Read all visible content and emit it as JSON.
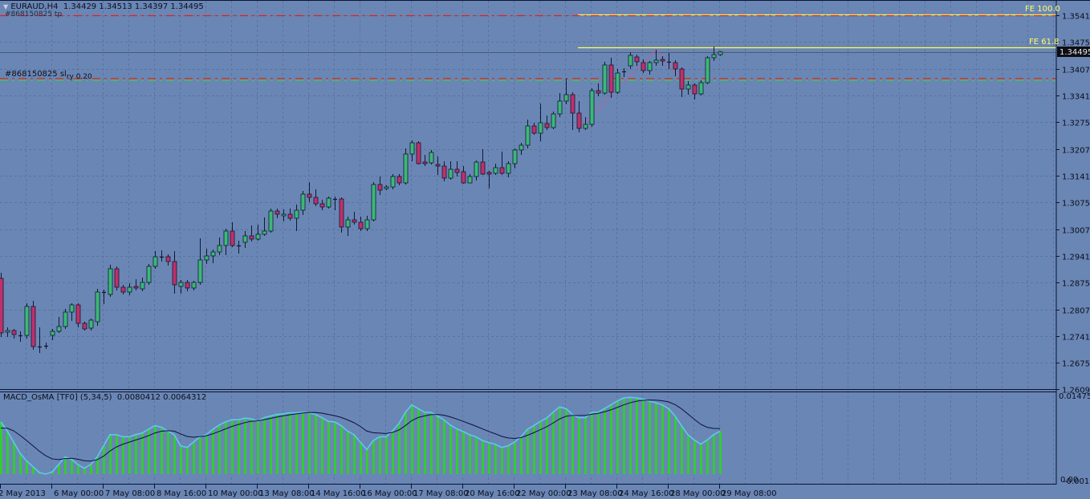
{
  "window": {
    "symbol_title": "EURAUD,H4",
    "ohlc_readout": "1.34429 1.34513 1.34397 1.34495"
  },
  "orders": {
    "tp_label": "#868150825 tp",
    "tp_price": 1.354,
    "sl_label": "#868150825 sl",
    "sl_suffix": "ry 0.20",
    "sl_price": 1.3383
  },
  "fibo": {
    "fe100_label": "FE 100.0",
    "fe100_price": 1.3543,
    "fe618_label": "FE 61.8",
    "fe618_price": 1.3461,
    "points": [
      [
        90,
        1.3259
      ],
      [
        102,
        1.3455
      ],
      [
        108,
        1.3343
      ]
    ]
  },
  "current_price": {
    "label": "1.34495",
    "value": 1.34495
  },
  "colors": {
    "background": "#6a86b5",
    "bull": "#3cb878",
    "bear": "#c0306a",
    "wick": "#0e1a33",
    "tp_line": "#e02020",
    "sl_line_green": "#3cd23c",
    "fibo_lines": "#ffff55",
    "fibo_trend": "#e0508a",
    "histogram": "#33cc33",
    "histogram_outline": "#5ec8f0",
    "signal": "#0a1040"
  },
  "price_axis": {
    "ticks": [
      "1.35410",
      "1.34750",
      "1.34070",
      "1.33410",
      "1.32750",
      "1.32070",
      "1.31410",
      "1.30750",
      "1.30070",
      "1.29410",
      "1.28750",
      "1.28070",
      "1.27410",
      "1.26750",
      "1.26090"
    ]
  },
  "time_axis": {
    "labels": [
      "2 May 2013",
      "6 May 00:00",
      "7 May 08:00",
      "8 May 16:00",
      "10 May 00:00",
      "13 May 08:00",
      "14 May 16:00",
      "16 May 00:00",
      "17 May 08:00",
      "20 May 16:00",
      "22 May 00:00",
      "23 May 08:00",
      "24 May 16:00",
      "28 May 00:00",
      "29 May 08:00"
    ]
  },
  "indicator": {
    "title": "MACD_OsMA [TF0] (5,34,5)",
    "value1": "0.0080412",
    "value2": "0.0064312",
    "scale_max": "0.014753",
    "scale_zero": "0.00",
    "scale_min": "-0.001059"
  },
  "chart_data": {
    "type": "candlestick",
    "candles": [
      [
        1.2885,
        1.2899,
        1.2739,
        1.2749
      ],
      [
        1.2751,
        1.2763,
        1.2739,
        1.2755
      ],
      [
        1.2755,
        1.2759,
        1.2735,
        1.2745
      ],
      [
        1.2743,
        1.2753,
        1.2727,
        1.2743
      ],
      [
        1.2743,
        1.2823,
        1.2735,
        1.2815
      ],
      [
        1.2815,
        1.2829,
        1.2707,
        1.2715
      ],
      [
        1.2715,
        1.2763,
        1.2699,
        1.2715
      ],
      [
        1.2717,
        1.2725,
        1.2709,
        1.2717
      ],
      [
        1.2743,
        1.2759,
        1.2731,
        1.2753
      ],
      [
        1.2753,
        1.2789,
        1.2749,
        1.2765
      ],
      [
        1.2765,
        1.2809,
        1.2759,
        1.2801
      ],
      [
        1.2801,
        1.2823,
        1.2779,
        1.2819
      ],
      [
        1.2819,
        1.2823,
        1.2763,
        1.2773
      ],
      [
        1.2773,
        1.2777,
        1.2755,
        1.2759
      ],
      [
        1.2761,
        1.2785,
        1.2755,
        1.2781
      ],
      [
        1.2777,
        1.2859,
        1.2767,
        1.2851
      ],
      [
        1.2851,
        1.2857,
        1.2821,
        1.2849
      ],
      [
        1.2845,
        1.2919,
        1.2839,
        1.2909
      ],
      [
        1.2909,
        1.2915,
        1.2855,
        1.2863
      ],
      [
        1.2863,
        1.2869,
        1.2845,
        1.2851
      ],
      [
        1.2851,
        1.2873,
        1.2843,
        1.2863
      ],
      [
        1.2865,
        1.2883,
        1.2855,
        1.2861
      ],
      [
        1.2859,
        1.2887,
        1.2853,
        1.2875
      ],
      [
        1.2875,
        1.2921,
        1.2869,
        1.2915
      ],
      [
        1.2915,
        1.2953,
        1.2909,
        1.2939
      ],
      [
        1.2939,
        1.2955,
        1.2927,
        1.2939
      ],
      [
        1.2939,
        1.2945,
        1.2917,
        1.2927
      ],
      [
        1.2927,
        1.2953,
        1.2847,
        1.2869
      ],
      [
        1.2865,
        1.2881,
        1.2847,
        1.2875
      ],
      [
        1.2875,
        1.2881,
        1.2853,
        1.2861
      ],
      [
        1.2861,
        1.2879,
        1.2855,
        1.2875
      ],
      [
        1.2875,
        1.2985,
        1.2869,
        1.2931
      ],
      [
        1.2931,
        1.2959,
        1.2921,
        1.2941
      ],
      [
        1.2941,
        1.2957,
        1.2923,
        1.2951
      ],
      [
        1.2951,
        1.2987,
        1.2943,
        1.2967
      ],
      [
        1.2967,
        1.3009,
        1.2943,
        1.3003
      ],
      [
        1.3003,
        1.3025,
        1.2963,
        1.2967
      ],
      [
        1.2967,
        1.2979,
        1.2947,
        1.2967
      ],
      [
        1.2975,
        1.3003,
        1.2961,
        1.2991
      ],
      [
        1.2991,
        1.3017,
        1.2977,
        1.2983
      ],
      [
        1.2983,
        1.3019,
        1.2979,
        1.2995
      ],
      [
        1.2995,
        1.3037,
        1.2991,
        1.3003
      ],
      [
        1.3003,
        1.3059,
        1.2999,
        1.3053
      ],
      [
        1.3053,
        1.3059,
        1.3035,
        1.3045
      ],
      [
        1.3041,
        1.3057,
        1.3027,
        1.3045
      ],
      [
        1.3045,
        1.3059,
        1.3029,
        1.3035
      ],
      [
        1.3035,
        1.3069,
        1.3003,
        1.3055
      ],
      [
        1.3055,
        1.3103,
        1.3043,
        1.3095
      ],
      [
        1.3095,
        1.3125,
        1.3075,
        1.3087
      ],
      [
        1.3087,
        1.3107,
        1.3065,
        1.3071
      ],
      [
        1.3071,
        1.3081,
        1.3055,
        1.3063
      ],
      [
        1.3063,
        1.3089,
        1.3059,
        1.3085
      ],
      [
        1.3083,
        1.3089,
        1.3055,
        1.3083
      ],
      [
        1.3083,
        1.3087,
        1.2999,
        1.3013
      ],
      [
        1.3013,
        1.3039,
        1.2991,
        1.3031
      ],
      [
        1.3031,
        1.3051,
        1.3019,
        1.3025
      ],
      [
        1.3025,
        1.3039,
        1.3003,
        1.3009
      ],
      [
        1.3009,
        1.3041,
        1.3003,
        1.3031
      ],
      [
        1.3031,
        1.3125,
        1.3027,
        1.3119
      ],
      [
        1.3119,
        1.3139,
        1.3093,
        1.3105
      ],
      [
        1.3109,
        1.3117,
        1.3105,
        1.3113
      ],
      [
        1.3113,
        1.3145,
        1.3107,
        1.3139
      ],
      [
        1.3139,
        1.3145,
        1.3117,
        1.3123
      ],
      [
        1.3123,
        1.3209,
        1.3119,
        1.3195
      ],
      [
        1.3195,
        1.3229,
        1.3177,
        1.3223
      ],
      [
        1.3223,
        1.3227,
        1.3169,
        1.3171
      ],
      [
        1.3175,
        1.3193,
        1.3165,
        1.3171
      ],
      [
        1.3173,
        1.3205,
        1.3169,
        1.3199
      ],
      [
        1.3169,
        1.3189,
        1.3143,
        1.3165
      ],
      [
        1.3165,
        1.3177,
        1.3127,
        1.3135
      ],
      [
        1.3135,
        1.3177,
        1.3131,
        1.3157
      ],
      [
        1.3157,
        1.3177,
        1.3139,
        1.3149
      ],
      [
        1.3151,
        1.3165,
        1.3121,
        1.3123
      ],
      [
        1.3123,
        1.3145,
        1.3129,
        1.3139
      ],
      [
        1.3139,
        1.3179,
        1.3129,
        1.3175
      ],
      [
        1.3175,
        1.3207,
        1.3143,
        1.3145
      ],
      [
        1.3149,
        1.3153,
        1.3109,
        1.3145
      ],
      [
        1.3147,
        1.3171,
        1.3143,
        1.3161
      ],
      [
        1.3161,
        1.3201,
        1.3143,
        1.3147
      ],
      [
        1.3147,
        1.3177,
        1.3137,
        1.3171
      ],
      [
        1.3171,
        1.3209,
        1.3159,
        1.3205
      ],
      [
        1.3205,
        1.3223,
        1.3193,
        1.3217
      ],
      [
        1.3217,
        1.3281,
        1.3209,
        1.3265
      ],
      [
        1.3265,
        1.3273,
        1.3243,
        1.3247
      ],
      [
        1.3247,
        1.3321,
        1.3227,
        1.3273
      ],
      [
        1.3271,
        1.3291,
        1.3255,
        1.3261
      ],
      [
        1.3261,
        1.3301,
        1.3257,
        1.3295
      ],
      [
        1.3295,
        1.3347,
        1.3287,
        1.3327
      ],
      [
        1.3327,
        1.3383,
        1.3319,
        1.3343
      ],
      [
        1.3343,
        1.3349,
        1.3255,
        1.3297
      ],
      [
        1.3297,
        1.3327,
        1.3249,
        1.3259
      ],
      [
        1.3259,
        1.3287,
        1.3255,
        1.3269
      ],
      [
        1.3269,
        1.3359,
        1.3263,
        1.3353
      ],
      [
        1.3353,
        1.3371,
        1.3339,
        1.3347
      ],
      [
        1.3347,
        1.3425,
        1.3343,
        1.3417
      ],
      [
        1.3417,
        1.3435,
        1.3335,
        1.3349
      ],
      [
        1.3349,
        1.3407,
        1.3345,
        1.3397
      ],
      [
        1.3401,
        1.3409,
        1.3387,
        1.3401
      ],
      [
        1.3415,
        1.3449,
        1.3407,
        1.3441
      ],
      [
        1.3437,
        1.3443,
        1.3415,
        1.3425
      ],
      [
        1.3423,
        1.3431,
        1.3397,
        1.3403
      ],
      [
        1.3403,
        1.3427,
        1.3393,
        1.3423
      ],
      [
        1.3423,
        1.3455,
        1.3415,
        1.3429
      ],
      [
        1.3431,
        1.3439,
        1.3415,
        1.3427
      ],
      [
        1.3425,
        1.3447,
        1.3407,
        1.3425
      ],
      [
        1.3423,
        1.3429,
        1.3389,
        1.3407
      ],
      [
        1.3407,
        1.3411,
        1.3337,
        1.3357
      ],
      [
        1.3357,
        1.3377,
        1.3343,
        1.3367
      ],
      [
        1.3367,
        1.3371,
        1.3331,
        1.3345
      ],
      [
        1.3345,
        1.3379,
        1.3341,
        1.3373
      ],
      [
        1.3373,
        1.3439,
        1.3369,
        1.3435
      ],
      [
        1.3435,
        1.3463,
        1.3427,
        1.3443
      ],
      [
        1.34429,
        1.34513,
        1.34397,
        1.34495
      ]
    ],
    "histogram": [
      0.0098,
      0.0081,
      0.006,
      0.0039,
      0.0025,
      0.0014,
      0.0003,
      0.0,
      0.0004,
      0.0018,
      0.0032,
      0.0028,
      0.0018,
      0.0011,
      0.0018,
      0.0032,
      0.0053,
      0.0074,
      0.0074,
      0.007,
      0.007,
      0.0074,
      0.0077,
      0.0084,
      0.0091,
      0.0088,
      0.0081,
      0.0074,
      0.0053,
      0.005,
      0.006,
      0.007,
      0.0074,
      0.0084,
      0.0092,
      0.0098,
      0.0102,
      0.0102,
      0.0105,
      0.0104,
      0.0099,
      0.0106,
      0.0109,
      0.0112,
      0.0113,
      0.0115,
      0.0115,
      0.0116,
      0.0115,
      0.0112,
      0.0106,
      0.0099,
      0.0098,
      0.0091,
      0.0081,
      0.0074,
      0.006,
      0.0046,
      0.0063,
      0.007,
      0.007,
      0.0081,
      0.0095,
      0.0116,
      0.013,
      0.0123,
      0.0116,
      0.0116,
      0.0109,
      0.0102,
      0.0092,
      0.0085,
      0.008,
      0.0074,
      0.007,
      0.0063,
      0.0059,
      0.0056,
      0.005,
      0.0053,
      0.006,
      0.007,
      0.0084,
      0.0091,
      0.0099,
      0.0105,
      0.0116,
      0.0126,
      0.0123,
      0.0112,
      0.0106,
      0.0106,
      0.0116,
      0.0116,
      0.0123,
      0.013,
      0.0137,
      0.0143,
      0.0144,
      0.0143,
      0.0141,
      0.0137,
      0.0134,
      0.013,
      0.0123,
      0.0109,
      0.0091,
      0.0074,
      0.0064,
      0.0056,
      0.0064,
      0.0074,
      0.0080412
    ],
    "price_range": [
      1.259,
      1.3579
    ],
    "indicator_range": [
      -0.001059,
      0.014753
    ],
    "grid": true
  }
}
